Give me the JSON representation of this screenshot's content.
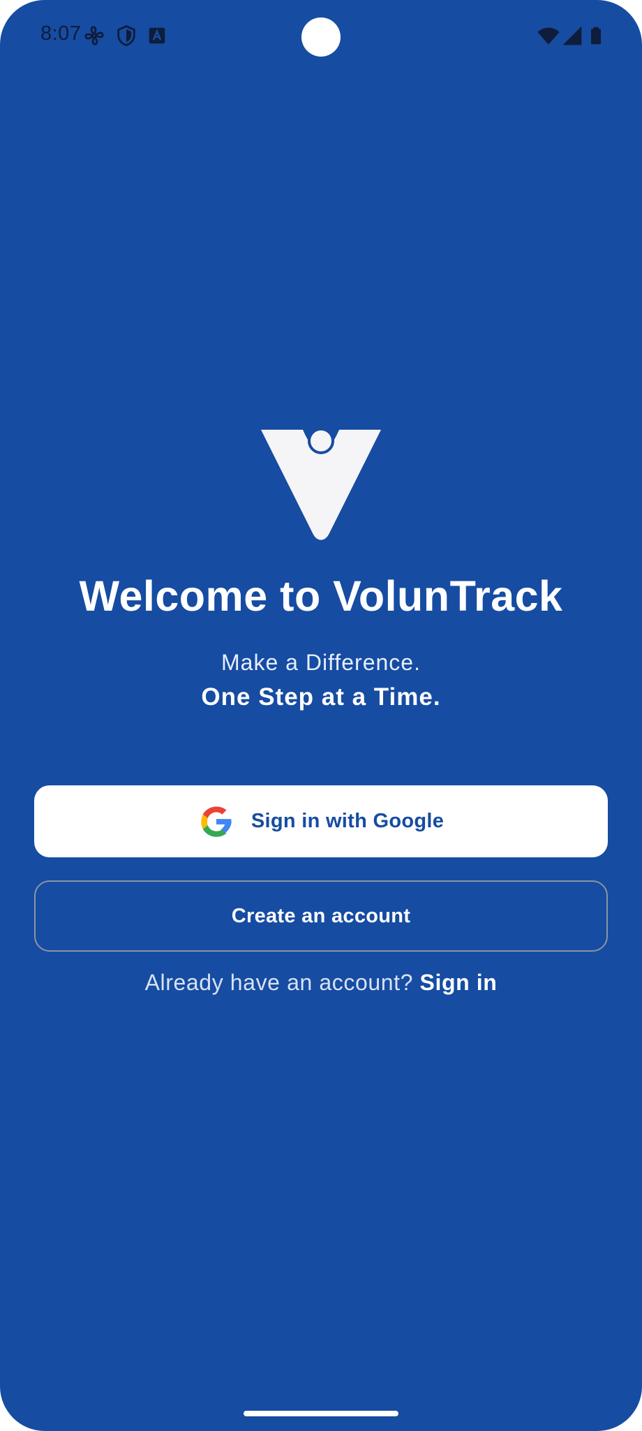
{
  "status_bar": {
    "time": "8:07",
    "left_icons": [
      "fan-icon",
      "shield-icon",
      "text-a-icon"
    ],
    "right_icons": [
      "wifi-icon",
      "signal-icon",
      "battery-icon"
    ]
  },
  "app": {
    "logo_icon": "voluntrack-logo-icon",
    "title": "Welcome to VolunTrack",
    "subtitle_line1": "Make a Difference.",
    "subtitle_line2": "One Step at a Time."
  },
  "actions": {
    "google_button_label": "Sign in with Google",
    "google_icon": "google-g-icon",
    "create_account_label": "Create an account",
    "signin_prompt": "Already have an account?",
    "signin_link": "Sign in"
  },
  "colors": {
    "background": "#164ca2",
    "button_fill": "#ffffff",
    "button_text": "#164ca2",
    "outline": "#8d94a4"
  }
}
